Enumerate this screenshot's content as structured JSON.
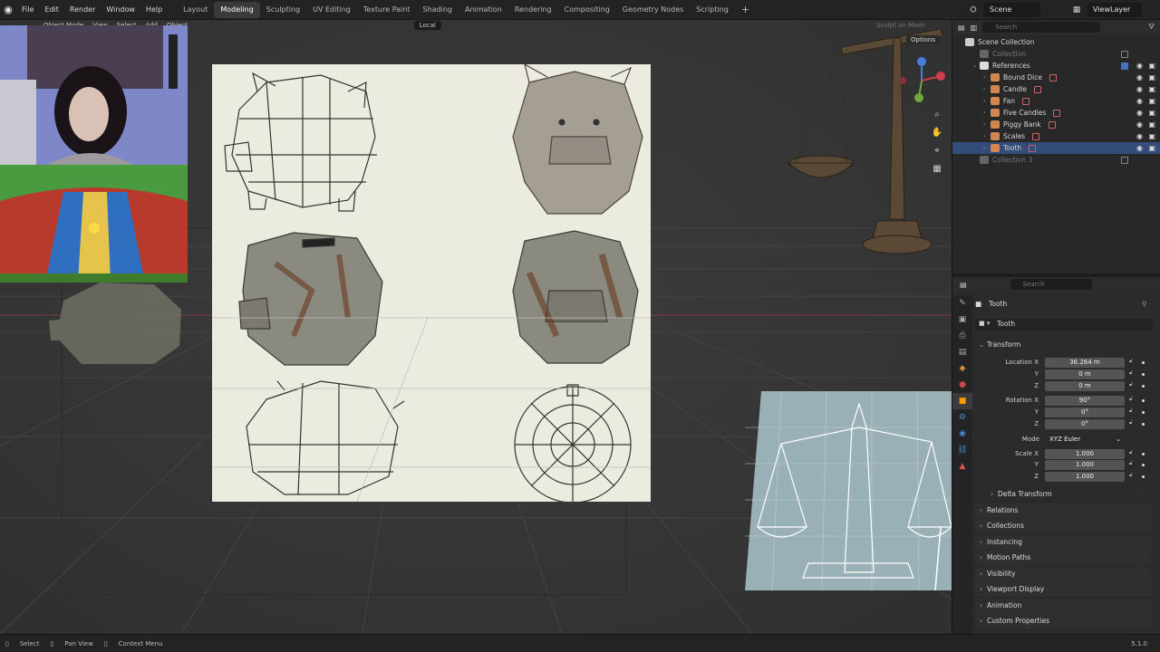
{
  "menu": [
    "File",
    "Edit",
    "Render",
    "Window",
    "Help"
  ],
  "workspaces": [
    {
      "label": "Layout",
      "active": false
    },
    {
      "label": "Modeling",
      "active": true
    },
    {
      "label": "Sculpting",
      "active": false
    },
    {
      "label": "UV Editing",
      "active": false
    },
    {
      "label": "Texture Paint",
      "active": false
    },
    {
      "label": "Shading",
      "active": false
    },
    {
      "label": "Animation",
      "active": false
    },
    {
      "label": "Rendering",
      "active": false
    },
    {
      "label": "Compositing",
      "active": false
    },
    {
      "label": "Geometry Nodes",
      "active": false
    },
    {
      "label": "Scripting",
      "active": false
    }
  ],
  "scene": {
    "name": "Scene",
    "view_layer": "ViewLayer"
  },
  "viewport_header": {
    "mode": "Object Mode",
    "view": "View",
    "select": "Select",
    "add": "Add",
    "object": "Object",
    "orientation": "Local",
    "sculpt_on_mesh": "Sculpt on Mesh",
    "options": "Options"
  },
  "outliner": {
    "search_placeholder": "Search",
    "scene_collection": "Scene Collection",
    "rows": [
      {
        "label": "Collection",
        "indent": 1,
        "dim": true,
        "selected": false
      },
      {
        "label": "References",
        "indent": 1,
        "dim": false,
        "selected": false
      },
      {
        "label": "Bound Dice",
        "indent": 2,
        "dim": false,
        "selected": false
      },
      {
        "label": "Candle",
        "indent": 2,
        "dim": false,
        "selected": false
      },
      {
        "label": "Fan",
        "indent": 2,
        "dim": false,
        "selected": false
      },
      {
        "label": "Five Candles",
        "indent": 2,
        "dim": false,
        "selected": false
      },
      {
        "label": "Piggy Bank",
        "indent": 2,
        "dim": false,
        "selected": false
      },
      {
        "label": "Scales",
        "indent": 2,
        "dim": false,
        "selected": false
      },
      {
        "label": "Tooth",
        "indent": 2,
        "dim": false,
        "selected": true
      },
      {
        "label": "Collection 3",
        "indent": 1,
        "dim": true,
        "selected": false
      }
    ]
  },
  "properties": {
    "search_placeholder": "Search",
    "object_name": "Tooth",
    "data_name": "Tooth",
    "transform_label": "Transform",
    "location": {
      "label": "Location X",
      "x": "36.264 m",
      "y": "0 m",
      "z": "0 m"
    },
    "rotation": {
      "label": "Rotation X",
      "x": "90°",
      "y": "0°",
      "z": "0°"
    },
    "mode": {
      "label": "Mode",
      "value": "XYZ Euler"
    },
    "scale": {
      "label": "Scale X",
      "x": "1.000",
      "y": "1.000",
      "z": "1.000"
    },
    "axis_y": "Y",
    "axis_z": "Z",
    "sections": [
      "Delta Transform",
      "Relations",
      "Collections",
      "Instancing",
      "Motion Paths",
      "Visibility",
      "Viewport Display",
      "Animation",
      "Custom Properties"
    ]
  },
  "status": {
    "select": "Select",
    "pan": "Pan View",
    "context": "Context Menu",
    "version": "5.1.0"
  },
  "colors": {
    "accent": "#4772b3",
    "selected_row": "#334c7a",
    "viewport_bg": "#3a3a3a"
  }
}
